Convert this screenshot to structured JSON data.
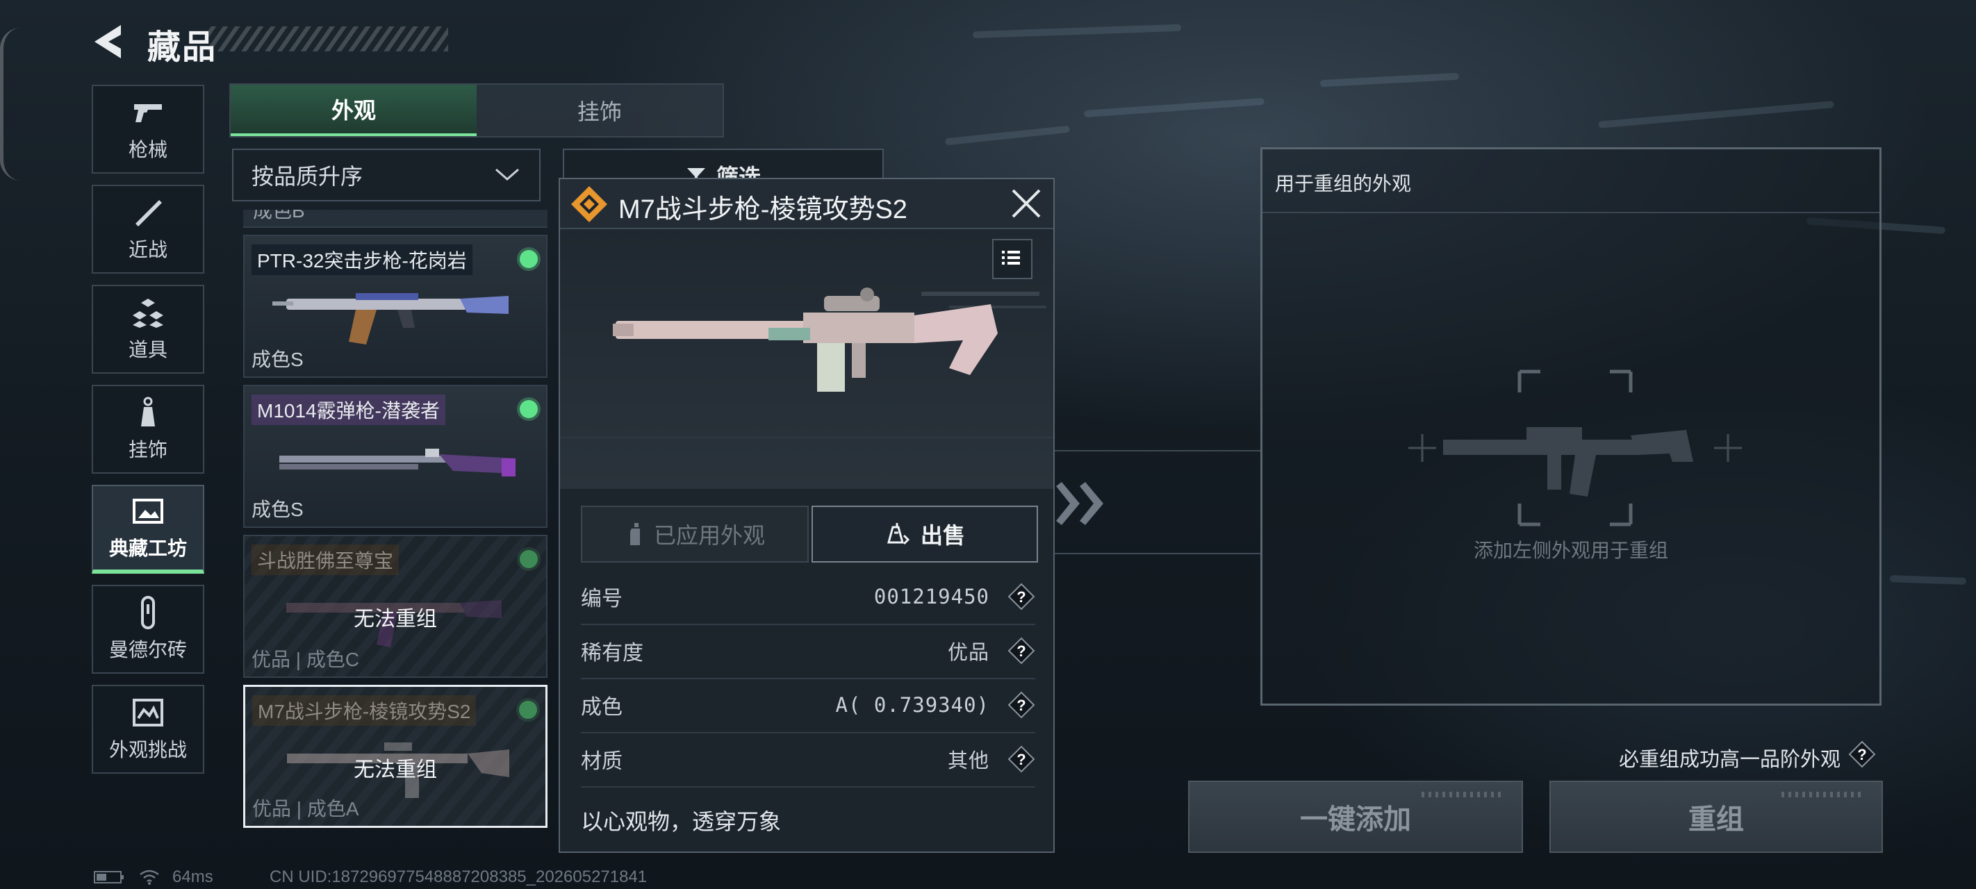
{
  "header": {
    "title": "藏品"
  },
  "sidebar": {
    "items": [
      {
        "label": "枪械",
        "icon": "pistol-icon"
      },
      {
        "label": "近战",
        "icon": "knife-icon"
      },
      {
        "label": "道具",
        "icon": "cubes-icon"
      },
      {
        "label": "挂饰",
        "icon": "charm-icon"
      },
      {
        "label": "典藏工坊",
        "icon": "gallery-icon",
        "active": true
      },
      {
        "label": "曼德尔砖",
        "icon": "brick-icon"
      },
      {
        "label": "外观挑战",
        "icon": "challenge-icon"
      }
    ]
  },
  "tabs": [
    {
      "label": "外观",
      "active": true
    },
    {
      "label": "挂饰",
      "active": false
    }
  ],
  "sort": {
    "value": "按品质升序"
  },
  "filter": {
    "label": "筛选"
  },
  "list": {
    "partial_label": "成色B",
    "items": [
      {
        "name": "PTR-32突击步枪-花岗岩",
        "grade": "成色S",
        "cannot": ""
      },
      {
        "name": "M1014霰弹枪-潜袭者",
        "grade": "成色S",
        "cannot": ""
      },
      {
        "name": "斗战胜佛至尊宝",
        "grade": "优品 | 成色C",
        "cannot": "无法重组"
      },
      {
        "name": "M7战斗步枪-棱镜攻势S2",
        "grade": "优品 | 成色A",
        "cannot": "无法重组"
      }
    ]
  },
  "detail": {
    "title": "M7战斗步枪-棱镜攻势S2",
    "applied_label": "已应用外观",
    "sell_label": "出售",
    "rows": [
      {
        "key": "编号",
        "value": "001219450"
      },
      {
        "key": "稀有度",
        "value": "优品"
      },
      {
        "key": "成色",
        "value": "A( 0.739340)"
      },
      {
        "key": "材质",
        "value": "其他"
      }
    ],
    "flavor": "以心观物，透穿万象"
  },
  "recombine": {
    "title": "用于重组的外观",
    "hint": "添加左侧外观用于重组",
    "guarantee": "必重组成功高一品阶外观",
    "quick_add_label": "一键添加",
    "recombine_label": "重组"
  },
  "footer": {
    "ping": "64ms",
    "uid": "CN UID:187296977548887208385_202605271841"
  },
  "colors": {
    "accent": "#7be39a",
    "tab_active": "#2e5a47",
    "rarity": "#e8962e"
  }
}
